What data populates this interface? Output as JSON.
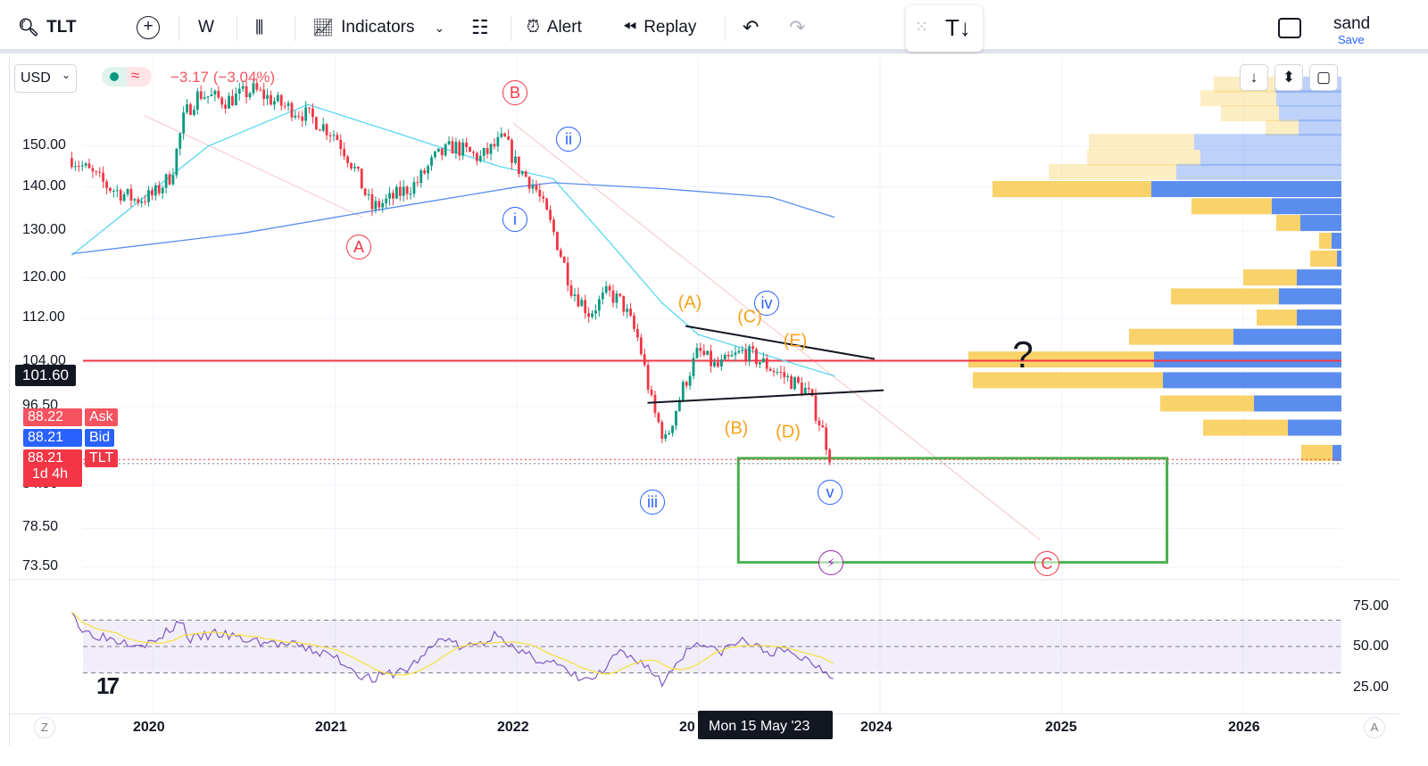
{
  "toolbar": {
    "symbol": "TLT",
    "interval": "W",
    "indicators": "Indicators",
    "alert": "Alert",
    "replay": "Replay",
    "user": "sand",
    "save": "Save"
  },
  "legend": {
    "currency": "USD",
    "change": "−3.17 (−3.04%)"
  },
  "price_axis": {
    "ticks": [
      "150.00",
      "140.00",
      "130.00",
      "120.00",
      "112.00",
      "104.00",
      "96.50",
      "84.50",
      "78.50",
      "73.50"
    ],
    "cursor_price": "101.60",
    "ask_price": "88.22",
    "ask_label": "Ask",
    "bid_price": "88.21",
    "bid_label": "Bid",
    "last_price": "88.21",
    "last_label": "TLT",
    "countdown": "1d 4h"
  },
  "rsi_axis": {
    "ticks": [
      "75.00",
      "50.00",
      "25.00"
    ]
  },
  "time_axis": {
    "ticks": [
      "2020",
      "2021",
      "2022",
      "20",
      "2024",
      "2025",
      "2026"
    ],
    "cursor_date": "Mon 15 May '23",
    "left_btn": "Z",
    "right_btn": "A"
  },
  "annotations": {
    "A": "A",
    "B": "B",
    "C": "C",
    "i": "i",
    "ii": "ii",
    "iii": "iii",
    "iv": "iv",
    "v": "v",
    "oA": "(A)",
    "oB": "(B)",
    "oC": "(C)",
    "oD": "(D)",
    "oE": "(E)",
    "q": "?"
  },
  "colors": {
    "up": "#089981",
    "down": "#f23645",
    "ma_fast": "#5ad8f0",
    "ma_slow": "#5b8def",
    "rsi": "#7e57c2",
    "rsi_ma": "#f5e13b",
    "level": "#f23645",
    "box": "#4caf50",
    "vp_up": "#f9d26a",
    "vp_down": "#5b8def"
  },
  "chart_data": {
    "type": "candlestick",
    "symbol": "TLT",
    "interval": "W",
    "scale": "log",
    "price_path": [
      [
        2019.55,
        147
      ],
      [
        2019.75,
        140
      ],
      [
        2019.9,
        137
      ],
      [
        2020.0,
        138
      ],
      [
        2020.1,
        143
      ],
      [
        2020.17,
        158
      ],
      [
        2020.25,
        164
      ],
      [
        2020.4,
        162
      ],
      [
        2020.55,
        165
      ],
      [
        2020.7,
        161
      ],
      [
        2020.85,
        158
      ],
      [
        2021.0,
        153
      ],
      [
        2021.1,
        145
      ],
      [
        2021.2,
        135
      ],
      [
        2021.3,
        137
      ],
      [
        2021.45,
        141
      ],
      [
        2021.55,
        147
      ],
      [
        2021.65,
        150
      ],
      [
        2021.8,
        147
      ],
      [
        2021.93,
        152
      ],
      [
        2022.0,
        145
      ],
      [
        2022.1,
        140
      ],
      [
        2022.2,
        130
      ],
      [
        2022.3,
        118
      ],
      [
        2022.4,
        113
      ],
      [
        2022.5,
        117
      ],
      [
        2022.58,
        115
      ],
      [
        2022.67,
        108
      ],
      [
        2022.75,
        96
      ],
      [
        2022.82,
        91
      ],
      [
        2022.92,
        100
      ],
      [
        2023.0,
        106
      ],
      [
        2023.1,
        103
      ],
      [
        2023.25,
        106
      ],
      [
        2023.35,
        104
      ],
      [
        2023.5,
        101
      ],
      [
        2023.6,
        99
      ],
      [
        2023.68,
        93
      ],
      [
        2023.73,
        88.21
      ]
    ],
    "ma_fast": [
      [
        2019.55,
        124.7
      ],
      [
        2020.3,
        150
      ],
      [
        2020.85,
        161
      ],
      [
        2021.3,
        154
      ],
      [
        2021.9,
        145
      ],
      [
        2022.2,
        142
      ],
      [
        2022.5,
        128
      ],
      [
        2022.8,
        115
      ],
      [
        2023.0,
        109
      ],
      [
        2023.4,
        105
      ],
      [
        2023.75,
        101.6
      ]
    ],
    "ma_slow": [
      [
        2019.55,
        125
      ],
      [
        2020.5,
        129.5
      ],
      [
        2021.2,
        134.4
      ],
      [
        2022.0,
        140
      ],
      [
        2022.2,
        141
      ],
      [
        2022.8,
        139.6
      ],
      [
        2023.4,
        137.6
      ],
      [
        2023.75,
        133
      ]
    ],
    "rsi": [
      [
        2019.55,
        80
      ],
      [
        2019.6,
        62
      ],
      [
        2019.8,
        55
      ],
      [
        2020.0,
        52
      ],
      [
        2020.15,
        70
      ],
      [
        2020.2,
        55
      ],
      [
        2020.35,
        60
      ],
      [
        2020.5,
        55
      ],
      [
        2020.8,
        50
      ],
      [
        2021.0,
        42
      ],
      [
        2021.15,
        28
      ],
      [
        2021.2,
        25
      ],
      [
        2021.4,
        33
      ],
      [
        2021.5,
        45
      ],
      [
        2021.6,
        58
      ],
      [
        2021.7,
        48
      ],
      [
        2021.85,
        55
      ],
      [
        2021.9,
        62
      ],
      [
        2022.0,
        45
      ],
      [
        2022.2,
        38
      ],
      [
        2022.3,
        28
      ],
      [
        2022.4,
        24
      ],
      [
        2022.5,
        33
      ],
      [
        2022.55,
        45
      ],
      [
        2022.7,
        38
      ],
      [
        2022.8,
        22
      ],
      [
        2022.9,
        42
      ],
      [
        2023.0,
        55
      ],
      [
        2023.1,
        45
      ],
      [
        2023.25,
        55
      ],
      [
        2023.35,
        47
      ],
      [
        2023.5,
        45
      ],
      [
        2023.6,
        40
      ],
      [
        2023.7,
        32
      ],
      [
        2023.75,
        27
      ]
    ],
    "rsi_levels": [
      70,
      50,
      30
    ],
    "horizontal_level": 104.3,
    "triangle": [
      [
        [
          2022.93,
          110.6
        ],
        [
          2023.97,
          104.6
        ]
      ],
      [
        [
          2022.72,
          97.1
        ],
        [
          2024.02,
          99.2
        ]
      ]
    ],
    "target_box": {
      "x": [
        2023.22,
        2025.58
      ],
      "price": [
        74.1,
        88.4
      ]
    },
    "volume_profile": [
      [
        166.5,
        68,
        75,
        1
      ],
      [
        162.7,
        85,
        73,
        1
      ],
      [
        158.6,
        65,
        70,
        1
      ],
      [
        154.8,
        37,
        48,
        1
      ],
      [
        151.1,
        118,
        165,
        1
      ],
      [
        147.1,
        127,
        158,
        1
      ],
      [
        143.6,
        143,
        185,
        1
      ],
      [
        139.5,
        178,
        213,
        0
      ],
      [
        135.5,
        90,
        78,
        0
      ],
      [
        131.7,
        27,
        46,
        0
      ],
      [
        127.8,
        14,
        11,
        0
      ],
      [
        124,
        30,
        5,
        0
      ],
      [
        120.1,
        60,
        50,
        0
      ],
      [
        116.3,
        121,
        70,
        0
      ],
      [
        112.2,
        45,
        50,
        0
      ],
      [
        108.6,
        117,
        121,
        0
      ],
      [
        104.5,
        208,
        210,
        0
      ],
      [
        100.9,
        213,
        200,
        0
      ],
      [
        97,
        105,
        98,
        0
      ],
      [
        93.1,
        95,
        60,
        0
      ],
      [
        89.2,
        35,
        10,
        0
      ]
    ]
  }
}
